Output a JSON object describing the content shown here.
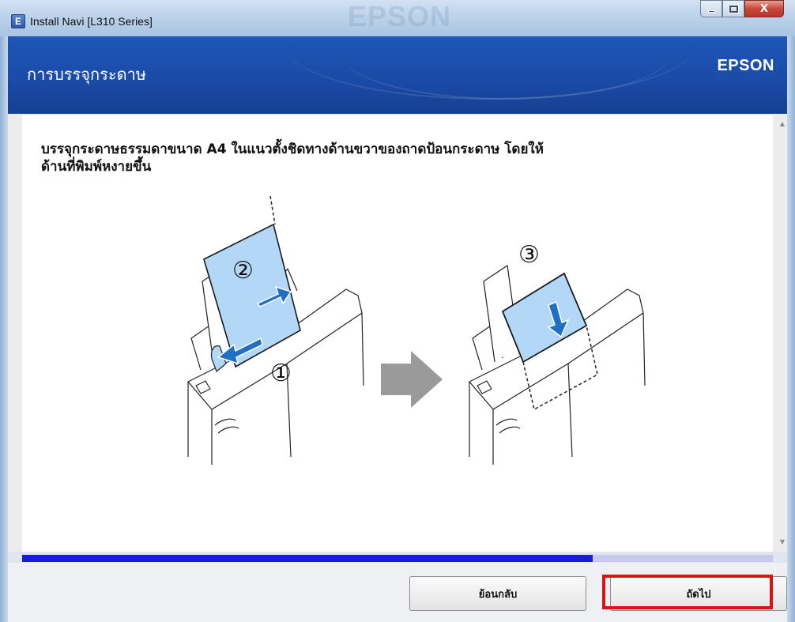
{
  "window": {
    "title": "Install Navi [L310 Series]",
    "app_icon_letter": "E",
    "watermark": "EPSON",
    "controls": {
      "minimize": "minimize",
      "maximize": "maximize",
      "close": "X"
    }
  },
  "header": {
    "title": "การบรรจุกระดาษ",
    "logo": "EPSON"
  },
  "content": {
    "instruction_line1": "บรรจุกระดาษธรรมดาขนาด A4 ในแนวตั้งชิดทางด้านขวาของถาดป้อนกระดาษ โดยให้",
    "instruction_line2": "ด้านที่พิมพ์หงายขึ้น",
    "steps": [
      "①",
      "②",
      "③"
    ]
  },
  "progress": {
    "value": 0.76
  },
  "footer": {
    "back_label": "ย้อนกลับ",
    "next_label": "ถัดไป"
  },
  "colors": {
    "header_blue": "#1a4aa6",
    "progress_fill": "#1b1be0",
    "progress_track": "#c9c9ef",
    "paper_blue": "#b3d8f7",
    "arrow_blue": "#1f6fc4",
    "highlight_red": "#e01010"
  }
}
